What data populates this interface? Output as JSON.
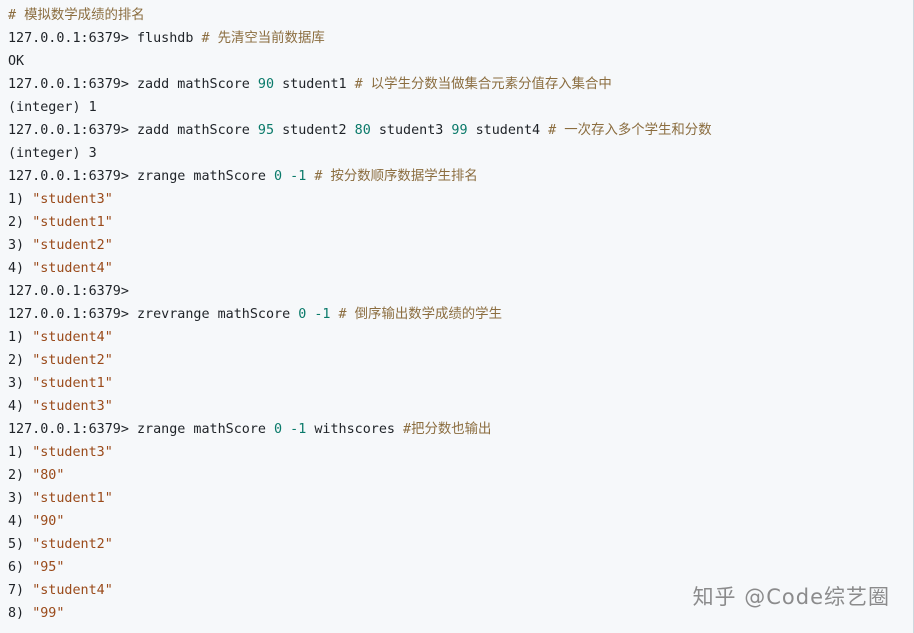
{
  "terminal": {
    "lines": [
      {
        "segments": [
          {
            "t": "comment",
            "v": "# 模拟数学成绩的排名"
          }
        ]
      },
      {
        "segments": [
          {
            "t": "prompt",
            "v": "127.0.0.1:6379> flushdb "
          },
          {
            "t": "comment",
            "v": "# 先清空当前数据库"
          }
        ]
      },
      {
        "segments": [
          {
            "t": "plain",
            "v": "OK"
          }
        ]
      },
      {
        "segments": [
          {
            "t": "prompt",
            "v": "127.0.0.1:6379> zadd mathScore "
          },
          {
            "t": "num",
            "v": "90"
          },
          {
            "t": "plain",
            "v": " student1 "
          },
          {
            "t": "comment",
            "v": "# 以学生分数当做集合元素分值存入集合中"
          }
        ]
      },
      {
        "segments": [
          {
            "t": "plain",
            "v": "(integer) 1"
          }
        ]
      },
      {
        "segments": [
          {
            "t": "prompt",
            "v": "127.0.0.1:6379> zadd mathScore "
          },
          {
            "t": "num",
            "v": "95"
          },
          {
            "t": "plain",
            "v": " student2 "
          },
          {
            "t": "num",
            "v": "80"
          },
          {
            "t": "plain",
            "v": " student3 "
          },
          {
            "t": "num",
            "v": "99"
          },
          {
            "t": "plain",
            "v": " student4 "
          },
          {
            "t": "comment",
            "v": "# 一次存入多个学生和分数"
          }
        ]
      },
      {
        "segments": [
          {
            "t": "plain",
            "v": "(integer) 3"
          }
        ]
      },
      {
        "segments": [
          {
            "t": "prompt",
            "v": "127.0.0.1:6379> zrange mathScore "
          },
          {
            "t": "num",
            "v": "0"
          },
          {
            "t": "plain",
            "v": " "
          },
          {
            "t": "num",
            "v": "-1"
          },
          {
            "t": "plain",
            "v": " "
          },
          {
            "t": "comment",
            "v": "# 按分数顺序数据学生排名"
          }
        ]
      },
      {
        "segments": [
          {
            "t": "plain",
            "v": "1) "
          },
          {
            "t": "str",
            "v": "\"student3\""
          }
        ]
      },
      {
        "segments": [
          {
            "t": "plain",
            "v": "2) "
          },
          {
            "t": "str",
            "v": "\"student1\""
          }
        ]
      },
      {
        "segments": [
          {
            "t": "plain",
            "v": "3) "
          },
          {
            "t": "str",
            "v": "\"student2\""
          }
        ]
      },
      {
        "segments": [
          {
            "t": "plain",
            "v": "4) "
          },
          {
            "t": "str",
            "v": "\"student4\""
          }
        ]
      },
      {
        "segments": [
          {
            "t": "prompt",
            "v": "127.0.0.1:6379>"
          }
        ]
      },
      {
        "segments": [
          {
            "t": "prompt",
            "v": "127.0.0.1:6379> zrevrange mathScore "
          },
          {
            "t": "num",
            "v": "0"
          },
          {
            "t": "plain",
            "v": " "
          },
          {
            "t": "num",
            "v": "-1"
          },
          {
            "t": "plain",
            "v": " "
          },
          {
            "t": "comment",
            "v": "# 倒序输出数学成绩的学生"
          }
        ]
      },
      {
        "segments": [
          {
            "t": "plain",
            "v": "1) "
          },
          {
            "t": "str",
            "v": "\"student4\""
          }
        ]
      },
      {
        "segments": [
          {
            "t": "plain",
            "v": "2) "
          },
          {
            "t": "str",
            "v": "\"student2\""
          }
        ]
      },
      {
        "segments": [
          {
            "t": "plain",
            "v": "3) "
          },
          {
            "t": "str",
            "v": "\"student1\""
          }
        ]
      },
      {
        "segments": [
          {
            "t": "plain",
            "v": "4) "
          },
          {
            "t": "str",
            "v": "\"student3\""
          }
        ]
      },
      {
        "segments": [
          {
            "t": "prompt",
            "v": "127.0.0.1:6379> zrange mathScore "
          },
          {
            "t": "num",
            "v": "0"
          },
          {
            "t": "plain",
            "v": " "
          },
          {
            "t": "num",
            "v": "-1"
          },
          {
            "t": "plain",
            "v": " withscores "
          },
          {
            "t": "comment",
            "v": "#把分数也输出"
          }
        ]
      },
      {
        "segments": [
          {
            "t": "plain",
            "v": "1) "
          },
          {
            "t": "str",
            "v": "\"student3\""
          }
        ]
      },
      {
        "segments": [
          {
            "t": "plain",
            "v": "2) "
          },
          {
            "t": "str",
            "v": "\"80\""
          }
        ]
      },
      {
        "segments": [
          {
            "t": "plain",
            "v": "3) "
          },
          {
            "t": "str",
            "v": "\"student1\""
          }
        ]
      },
      {
        "segments": [
          {
            "t": "plain",
            "v": "4) "
          },
          {
            "t": "str",
            "v": "\"90\""
          }
        ]
      },
      {
        "segments": [
          {
            "t": "plain",
            "v": "5) "
          },
          {
            "t": "str",
            "v": "\"student2\""
          }
        ]
      },
      {
        "segments": [
          {
            "t": "plain",
            "v": "6) "
          },
          {
            "t": "str",
            "v": "\"95\""
          }
        ]
      },
      {
        "segments": [
          {
            "t": "plain",
            "v": "7) "
          },
          {
            "t": "str",
            "v": "\"student4\""
          }
        ]
      },
      {
        "segments": [
          {
            "t": "plain",
            "v": "8) "
          },
          {
            "t": "str",
            "v": "\"99\""
          }
        ]
      }
    ]
  },
  "watermark": "知乎 @Code综艺圈",
  "colors": {
    "background": "#f6f8fa",
    "text": "#1f2328",
    "comment": "#8b6d3f",
    "number": "#0a7a6a",
    "string": "#9a4a1a"
  }
}
